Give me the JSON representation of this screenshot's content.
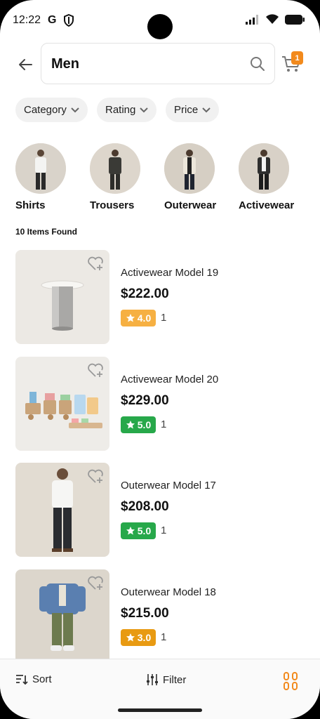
{
  "status_bar": {
    "time": "12:22",
    "g_label": "G"
  },
  "search": {
    "query": "Men"
  },
  "cart": {
    "badge_count": "1",
    "accent": "#f28a1d"
  },
  "filters": [
    {
      "label": "Category"
    },
    {
      "label": "Rating"
    },
    {
      "label": "Price"
    }
  ],
  "categories": [
    {
      "label": "Shirts"
    },
    {
      "label": "Trousers"
    },
    {
      "label": "Outerwear"
    },
    {
      "label": "Activewear"
    }
  ],
  "results": {
    "count_label": "10 Items Found"
  },
  "products": [
    {
      "name": "Activewear Model 19",
      "price": "$222.00",
      "rating": "4.0",
      "rating_color": "#f6b042",
      "count": "1",
      "image": "steel-side-table"
    },
    {
      "name": "Activewear Model 20",
      "price": "$229.00",
      "rating": "5.0",
      "rating_color": "#27a84a",
      "count": "1",
      "image": "wooden-toy-train"
    },
    {
      "name": "Outerwear Model 17",
      "price": "$208.00",
      "rating": "5.0",
      "rating_color": "#27a84a",
      "count": "1",
      "image": "man-white-shirt"
    },
    {
      "name": "Outerwear Model 18",
      "price": "$215.00",
      "rating": "3.0",
      "rating_color": "#e89a12",
      "count": "1",
      "image": "kids-denim-jacket"
    }
  ],
  "bottom_bar": {
    "sort_label": "Sort",
    "filter_label": "Filter"
  }
}
